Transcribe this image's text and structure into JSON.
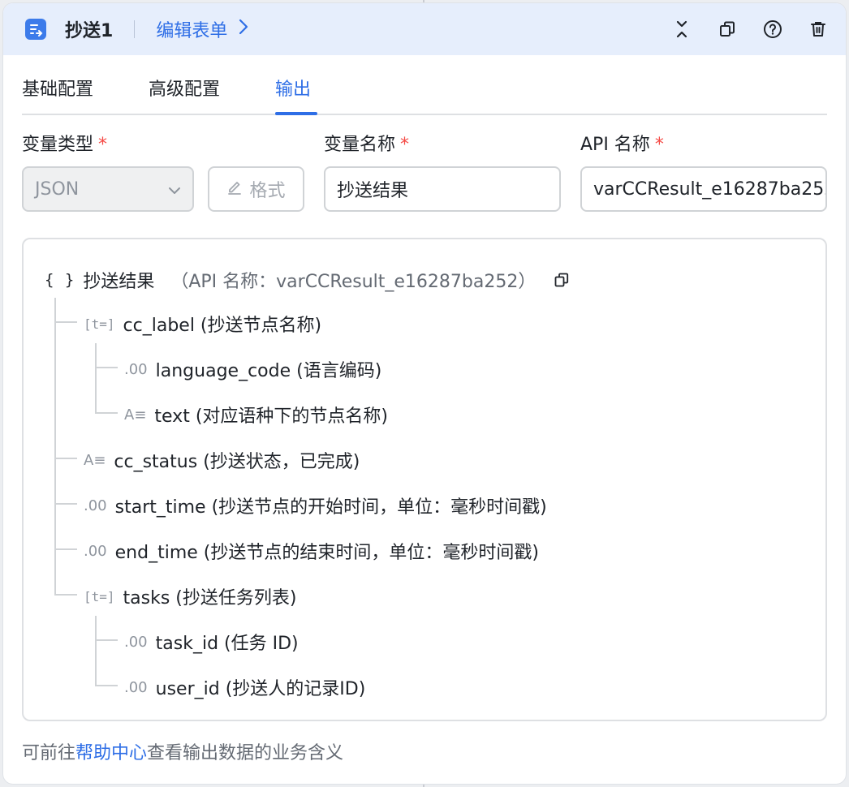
{
  "header": {
    "title": "抄送1",
    "link_label": "编辑表单",
    "icon": "form-icon",
    "actions": [
      "collapse-icon",
      "copy-icon",
      "help-icon",
      "delete-icon"
    ]
  },
  "tabs": [
    {
      "label": "基础配置",
      "active": false
    },
    {
      "label": "高级配置",
      "active": false
    },
    {
      "label": "输出",
      "active": true
    }
  ],
  "fields": {
    "var_type": {
      "label": "变量类型",
      "value": "JSON"
    },
    "format_button": "格式",
    "var_name": {
      "label": "变量名称",
      "value": "抄送结果"
    },
    "api_name": {
      "label": "API 名称",
      "value": "varCCResult_e16287ba252"
    },
    "required_mark": "*"
  },
  "tree": {
    "root": {
      "braces": "{ }",
      "name": "抄送结果",
      "api": "（API 名称：varCCResult_e16287ba252）"
    },
    "nodes": [
      {
        "type_icon": "[t=]",
        "label": "cc_label (抄送节点名称)"
      },
      {
        "type_icon": ".00",
        "label": "language_code (语言编码)"
      },
      {
        "type_icon": "A≡",
        "label": "text (对应语种下的节点名称)"
      },
      {
        "type_icon": "A≡",
        "label": "cc_status (抄送状态，已完成)"
      },
      {
        "type_icon": ".00",
        "label": "start_time (抄送节点的开始时间，单位：毫秒时间戳)"
      },
      {
        "type_icon": ".00",
        "label": "end_time (抄送节点的结束时间，单位：毫秒时间戳)"
      },
      {
        "type_icon": "[t=]",
        "label": "tasks (抄送任务列表)"
      },
      {
        "type_icon": ".00",
        "label": "task_id (任务 ID)"
      },
      {
        "type_icon": ".00",
        "label": "user_id (抄送人的记录ID)"
      }
    ]
  },
  "footer": {
    "prefix": "可前往",
    "link": "帮助中心",
    "suffix": "查看输出数据的业务含义"
  },
  "colors": {
    "accent": "#2e6ee6",
    "header_bg": "#e6eefc",
    "required": "#f54a45"
  }
}
